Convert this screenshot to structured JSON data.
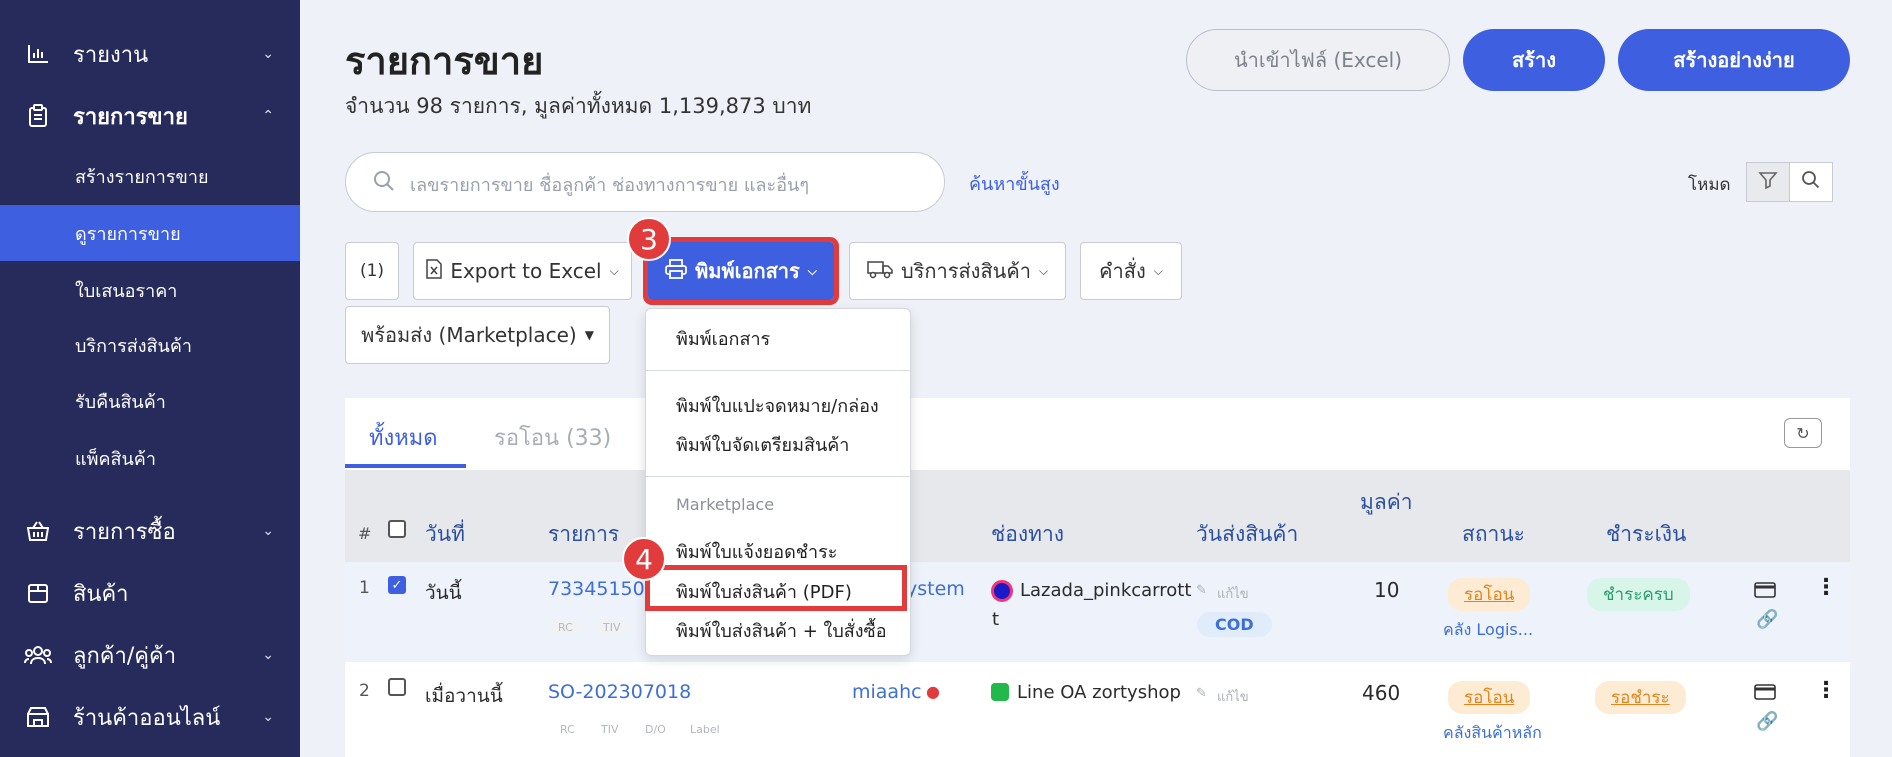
{
  "sidebar": {
    "items": [
      {
        "label": "รายงาน"
      },
      {
        "label": "รายการขาย"
      },
      {
        "label": "รายการซื้อ"
      },
      {
        "label": "สินค้า"
      },
      {
        "label": "ลูกค้า/คู่ค้า"
      },
      {
        "label": "ร้านค้าออนไลน์"
      }
    ],
    "sub_items": [
      {
        "label": "สร้างรายการขาย"
      },
      {
        "label": "ดูรายการขาย"
      },
      {
        "label": "ใบเสนอราคา"
      },
      {
        "label": "บริการส่งสินค้า"
      },
      {
        "label": "รับคืนสินค้า"
      },
      {
        "label": "แพ็คสินค้า"
      }
    ]
  },
  "header": {
    "title": "รายการขาย",
    "subtitle": "จำนวน 98 รายการ, มูลค่าทั้งหมด 1,139,873 บาท",
    "import_label": "นำเข้าไฟล์ (Excel)",
    "create_label": "สร้าง",
    "create_easy_label": "สร้างอย่างง่าย"
  },
  "search": {
    "placeholder": "เลขรายการขาย ชื่อลูกค้า ช่องทางการขาย และอื่นๆ",
    "advanced_label": "ค้นหาขั้นสูง",
    "mode_label": "โหมด"
  },
  "toolbar": {
    "selected_count": "(1)",
    "export_label": "Export to Excel",
    "print_label": "พิมพ์เอกสาร",
    "shipping_label": "บริการส่งสินค้า",
    "command_label": "คำสั่ง",
    "ready_label": "พร้อมส่ง (Marketplace)"
  },
  "steps": {
    "step3": "3",
    "step4": "4"
  },
  "dropdown": {
    "items": [
      "พิมพ์เอกสาร",
      "พิมพ์ใบแปะจดหมาย/กล่อง",
      "พิมพ์ใบจัดเตรียมสินค้า",
      "พิมพ์ใบแจ้งยอดชำระ",
      "พิมพ์ใบส่งสินค้า (PDF)",
      "พิมพ์ใบส่งสินค้า + ใบสั่งซื้อ"
    ],
    "marketplace_header": "Marketplace"
  },
  "tabs": [
    {
      "label": "ทั้งหมด"
    },
    {
      "label": "รอโอน (33)"
    }
  ],
  "table": {
    "headers": {
      "num": "#",
      "date": "วันที่",
      "order": "รายการ",
      "channel": "ช่องทาง",
      "ship_date": "วันส่งสินค้า",
      "value": "มูลค่า",
      "status": "สถานะ",
      "payment": "ชำระเงิน"
    },
    "rows": [
      {
        "num": "1",
        "date": "วันนี้",
        "order": "73345150",
        "customer": "ystem",
        "channel": "Lazada_pinkcarrott",
        "channel_wrap": "t",
        "edit": "แก้ไข",
        "ship_badge": "COD",
        "value": "10",
        "status": "รอโอน",
        "warehouse": "คลัง Logis...",
        "payment": "ชำระครบ",
        "tags": [
          "RC",
          "TIV"
        ]
      },
      {
        "num": "2",
        "date": "เมื่อวานนี้",
        "order": "SO-202307018",
        "customer": "miaahc",
        "channel": "Line OA zortyshop",
        "edit": "แก้ไข",
        "value": "460",
        "status": "รอโอน",
        "warehouse": "คลังสินค้าหลัก",
        "payment": "รอชำระ",
        "tags": [
          "RC",
          "TIV",
          "D/O",
          "Label"
        ]
      }
    ]
  },
  "colors": {
    "sidebar_bg": "#262b5c",
    "accent": "#3d5fe0",
    "highlight": "#e23b3b"
  }
}
